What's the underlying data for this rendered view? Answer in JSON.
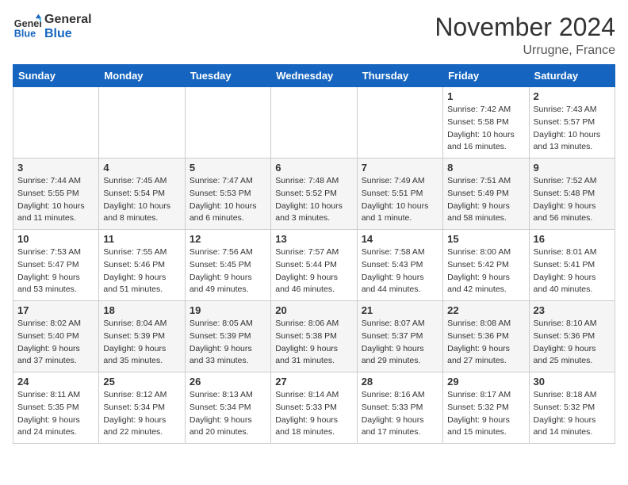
{
  "logo": {
    "line1": "General",
    "line2": "Blue"
  },
  "title": "November 2024",
  "location": "Urrugne, France",
  "weekdays": [
    "Sunday",
    "Monday",
    "Tuesday",
    "Wednesday",
    "Thursday",
    "Friday",
    "Saturday"
  ],
  "weeks": [
    [
      {
        "day": "",
        "info": ""
      },
      {
        "day": "",
        "info": ""
      },
      {
        "day": "",
        "info": ""
      },
      {
        "day": "",
        "info": ""
      },
      {
        "day": "",
        "info": ""
      },
      {
        "day": "1",
        "info": "Sunrise: 7:42 AM\nSunset: 5:58 PM\nDaylight: 10 hours and 16 minutes."
      },
      {
        "day": "2",
        "info": "Sunrise: 7:43 AM\nSunset: 5:57 PM\nDaylight: 10 hours and 13 minutes."
      }
    ],
    [
      {
        "day": "3",
        "info": "Sunrise: 7:44 AM\nSunset: 5:55 PM\nDaylight: 10 hours and 11 minutes."
      },
      {
        "day": "4",
        "info": "Sunrise: 7:45 AM\nSunset: 5:54 PM\nDaylight: 10 hours and 8 minutes."
      },
      {
        "day": "5",
        "info": "Sunrise: 7:47 AM\nSunset: 5:53 PM\nDaylight: 10 hours and 6 minutes."
      },
      {
        "day": "6",
        "info": "Sunrise: 7:48 AM\nSunset: 5:52 PM\nDaylight: 10 hours and 3 minutes."
      },
      {
        "day": "7",
        "info": "Sunrise: 7:49 AM\nSunset: 5:51 PM\nDaylight: 10 hours and 1 minute."
      },
      {
        "day": "8",
        "info": "Sunrise: 7:51 AM\nSunset: 5:49 PM\nDaylight: 9 hours and 58 minutes."
      },
      {
        "day": "9",
        "info": "Sunrise: 7:52 AM\nSunset: 5:48 PM\nDaylight: 9 hours and 56 minutes."
      }
    ],
    [
      {
        "day": "10",
        "info": "Sunrise: 7:53 AM\nSunset: 5:47 PM\nDaylight: 9 hours and 53 minutes."
      },
      {
        "day": "11",
        "info": "Sunrise: 7:55 AM\nSunset: 5:46 PM\nDaylight: 9 hours and 51 minutes."
      },
      {
        "day": "12",
        "info": "Sunrise: 7:56 AM\nSunset: 5:45 PM\nDaylight: 9 hours and 49 minutes."
      },
      {
        "day": "13",
        "info": "Sunrise: 7:57 AM\nSunset: 5:44 PM\nDaylight: 9 hours and 46 minutes."
      },
      {
        "day": "14",
        "info": "Sunrise: 7:58 AM\nSunset: 5:43 PM\nDaylight: 9 hours and 44 minutes."
      },
      {
        "day": "15",
        "info": "Sunrise: 8:00 AM\nSunset: 5:42 PM\nDaylight: 9 hours and 42 minutes."
      },
      {
        "day": "16",
        "info": "Sunrise: 8:01 AM\nSunset: 5:41 PM\nDaylight: 9 hours and 40 minutes."
      }
    ],
    [
      {
        "day": "17",
        "info": "Sunrise: 8:02 AM\nSunset: 5:40 PM\nDaylight: 9 hours and 37 minutes."
      },
      {
        "day": "18",
        "info": "Sunrise: 8:04 AM\nSunset: 5:39 PM\nDaylight: 9 hours and 35 minutes."
      },
      {
        "day": "19",
        "info": "Sunrise: 8:05 AM\nSunset: 5:39 PM\nDaylight: 9 hours and 33 minutes."
      },
      {
        "day": "20",
        "info": "Sunrise: 8:06 AM\nSunset: 5:38 PM\nDaylight: 9 hours and 31 minutes."
      },
      {
        "day": "21",
        "info": "Sunrise: 8:07 AM\nSunset: 5:37 PM\nDaylight: 9 hours and 29 minutes."
      },
      {
        "day": "22",
        "info": "Sunrise: 8:08 AM\nSunset: 5:36 PM\nDaylight: 9 hours and 27 minutes."
      },
      {
        "day": "23",
        "info": "Sunrise: 8:10 AM\nSunset: 5:36 PM\nDaylight: 9 hours and 25 minutes."
      }
    ],
    [
      {
        "day": "24",
        "info": "Sunrise: 8:11 AM\nSunset: 5:35 PM\nDaylight: 9 hours and 24 minutes."
      },
      {
        "day": "25",
        "info": "Sunrise: 8:12 AM\nSunset: 5:34 PM\nDaylight: 9 hours and 22 minutes."
      },
      {
        "day": "26",
        "info": "Sunrise: 8:13 AM\nSunset: 5:34 PM\nDaylight: 9 hours and 20 minutes."
      },
      {
        "day": "27",
        "info": "Sunrise: 8:14 AM\nSunset: 5:33 PM\nDaylight: 9 hours and 18 minutes."
      },
      {
        "day": "28",
        "info": "Sunrise: 8:16 AM\nSunset: 5:33 PM\nDaylight: 9 hours and 17 minutes."
      },
      {
        "day": "29",
        "info": "Sunrise: 8:17 AM\nSunset: 5:32 PM\nDaylight: 9 hours and 15 minutes."
      },
      {
        "day": "30",
        "info": "Sunrise: 8:18 AM\nSunset: 5:32 PM\nDaylight: 9 hours and 14 minutes."
      }
    ]
  ]
}
